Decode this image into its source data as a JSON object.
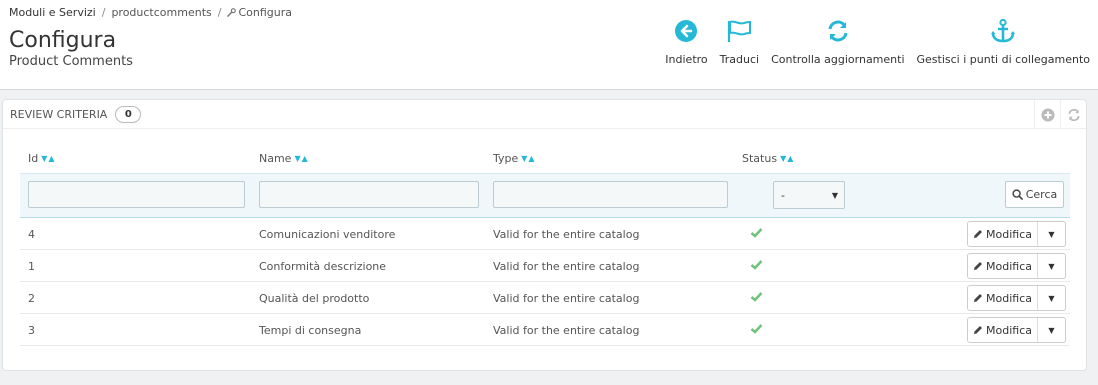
{
  "breadcrumb": {
    "items": [
      "Moduli e Servizi",
      "productcomments",
      "Configura"
    ],
    "separator": "/"
  },
  "header": {
    "title": "Configura",
    "subtitle": "Product Comments"
  },
  "toolbar": {
    "back": {
      "label": "Indietro",
      "icon": "arrow-circle-left-icon"
    },
    "translate": {
      "label": "Traduci",
      "icon": "flag-icon"
    },
    "updates": {
      "label": "Controlla aggiornamenti",
      "icon": "refresh-icon"
    },
    "hooks": {
      "label": "Gestisci i punti di collegamento",
      "icon": "anchor-icon"
    }
  },
  "panel": {
    "title": "Review Criteria",
    "count": "0",
    "actions": [
      "add-icon",
      "refresh-icon"
    ]
  },
  "table": {
    "columns": [
      "Id",
      "Name",
      "Type",
      "Status"
    ],
    "filter": {
      "status_value": "-",
      "search_label": "Cerca"
    },
    "rows": [
      {
        "id": "4",
        "name": "Comunicazioni venditore",
        "type": "Valid for the entire catalog",
        "status": "enabled"
      },
      {
        "id": "1",
        "name": "Conformità descrizione",
        "type": "Valid for the entire catalog",
        "status": "enabled"
      },
      {
        "id": "2",
        "name": "Qualità del prodotto",
        "type": "Valid for the entire catalog",
        "status": "enabled"
      },
      {
        "id": "3",
        "name": "Tempi di consegna",
        "type": "Valid for the entire catalog",
        "status": "enabled"
      }
    ],
    "edit_label": "Modifica"
  },
  "colors": {
    "accent": "#25b9d7",
    "success": "#72c279",
    "muted_icon": "#bbbbbb"
  }
}
